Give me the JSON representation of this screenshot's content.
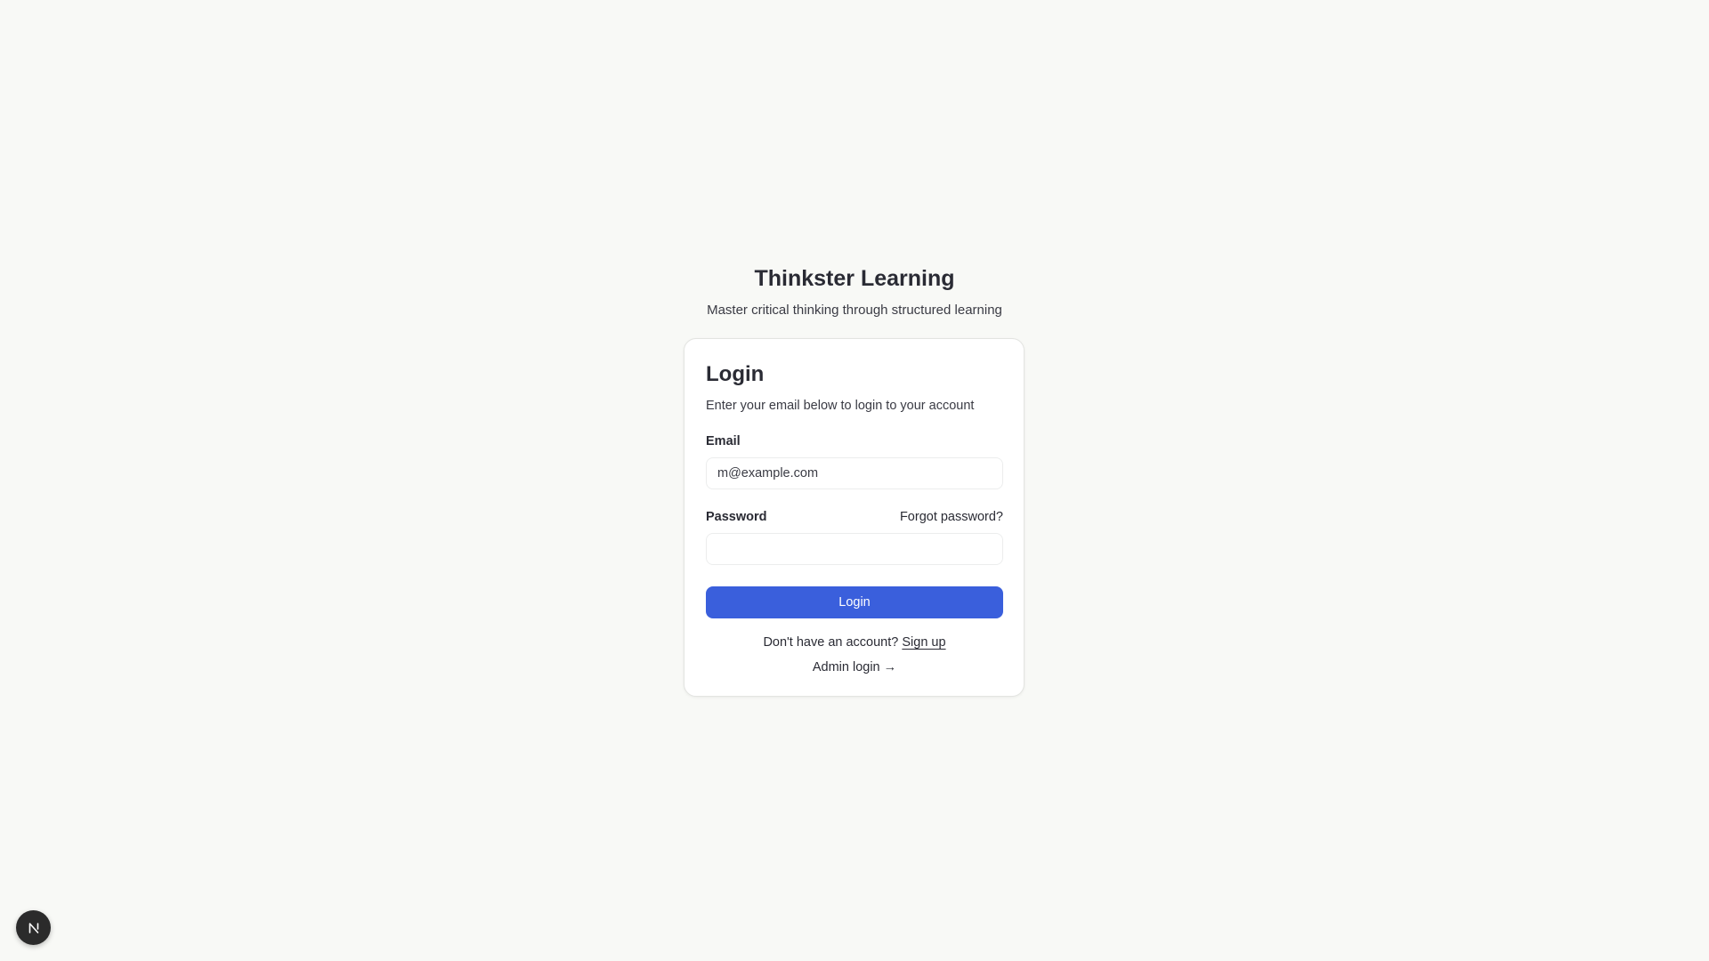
{
  "header": {
    "title": "Thinkster Learning",
    "subtitle": "Master critical thinking through structured learning"
  },
  "login_card": {
    "title": "Login",
    "description": "Enter your email below to login to your account",
    "email": {
      "label": "Email",
      "placeholder": "m@example.com",
      "value": ""
    },
    "password": {
      "label": "Password",
      "value": "",
      "forgot_label": "Forgot password?"
    },
    "submit_label": "Login",
    "signup": {
      "prompt": "Don't have an account?",
      "link_label": "Sign up"
    },
    "admin_link_label": "Admin login →"
  },
  "dev_badge": {
    "icon": "nextjs-logo-icon"
  },
  "colors": {
    "background": "#f8f9f6",
    "accent": "#3a5fdc",
    "text": "#2a2b34",
    "badge": "#2b2b2b"
  }
}
